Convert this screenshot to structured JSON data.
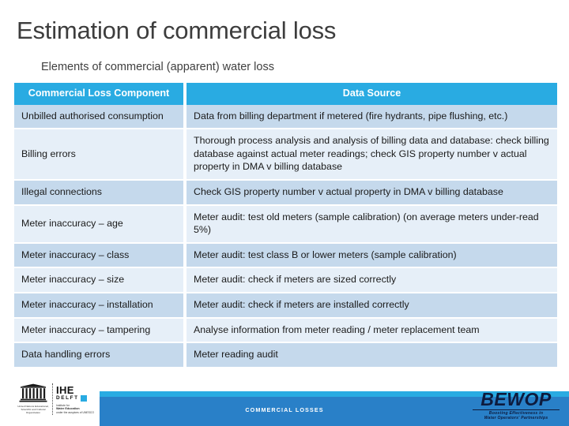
{
  "slide": {
    "title": "Estimation of commercial loss",
    "subtitle": "Elements of commercial (apparent) water loss"
  },
  "table": {
    "headers": {
      "component": "Commercial Loss Component",
      "source": "Data Source"
    },
    "rows": [
      {
        "component": "Unbilled authorised consumption",
        "source": "Data from billing department if metered (fire hydrants, pipe flushing, etc.)"
      },
      {
        "component": "Billing errors",
        "source": "Thorough process analysis and analysis of billing data and database: check billing database against actual meter readings; check GIS property number v actual property in DMA v billing database"
      },
      {
        "component": "Illegal connections",
        "source": "Check GIS property number v actual property in DMA v billing database"
      },
      {
        "component": "Meter inaccuracy – age",
        "source": "Meter audit: test old meters (sample calibration) (on average meters under-read 5%)"
      },
      {
        "component": "Meter inaccuracy – class",
        "source": "Meter audit: test class B or lower meters (sample calibration)"
      },
      {
        "component": "Meter inaccuracy – size",
        "source": "Meter audit: check if meters are sized correctly"
      },
      {
        "component": "Meter inaccuracy – installation",
        "source": "Meter audit: check if meters are installed correctly"
      },
      {
        "component": "Meter inaccuracy – tampering",
        "source": "Analyse information from meter reading / meter replacement team"
      },
      {
        "component": "Data handling errors",
        "source": "Meter reading audit"
      }
    ]
  },
  "footer": {
    "center_text": "COMMERCIAL LOSSES",
    "unesco_caption": "United Nations Educational, Scientific and Cultural Organization",
    "ihe_word": "IHE",
    "ihe_delft": "DELFT",
    "ihe_caption_line1": "Institute for",
    "ihe_caption_line2": "Water Education",
    "ihe_caption_line3": "under the auspices of UNESCO",
    "bewop_word": "BEWOP",
    "bewop_tagline_line1": "Boosting Effectiveness in",
    "bewop_tagline_line2": "Water Operators' Partnerships"
  },
  "colors": {
    "header_blue": "#29ABE2",
    "footer_blue": "#2980C8",
    "row_dark": "#C5D9EC",
    "row_light": "#E6EFF8",
    "title_text": "#3D3D3D"
  }
}
